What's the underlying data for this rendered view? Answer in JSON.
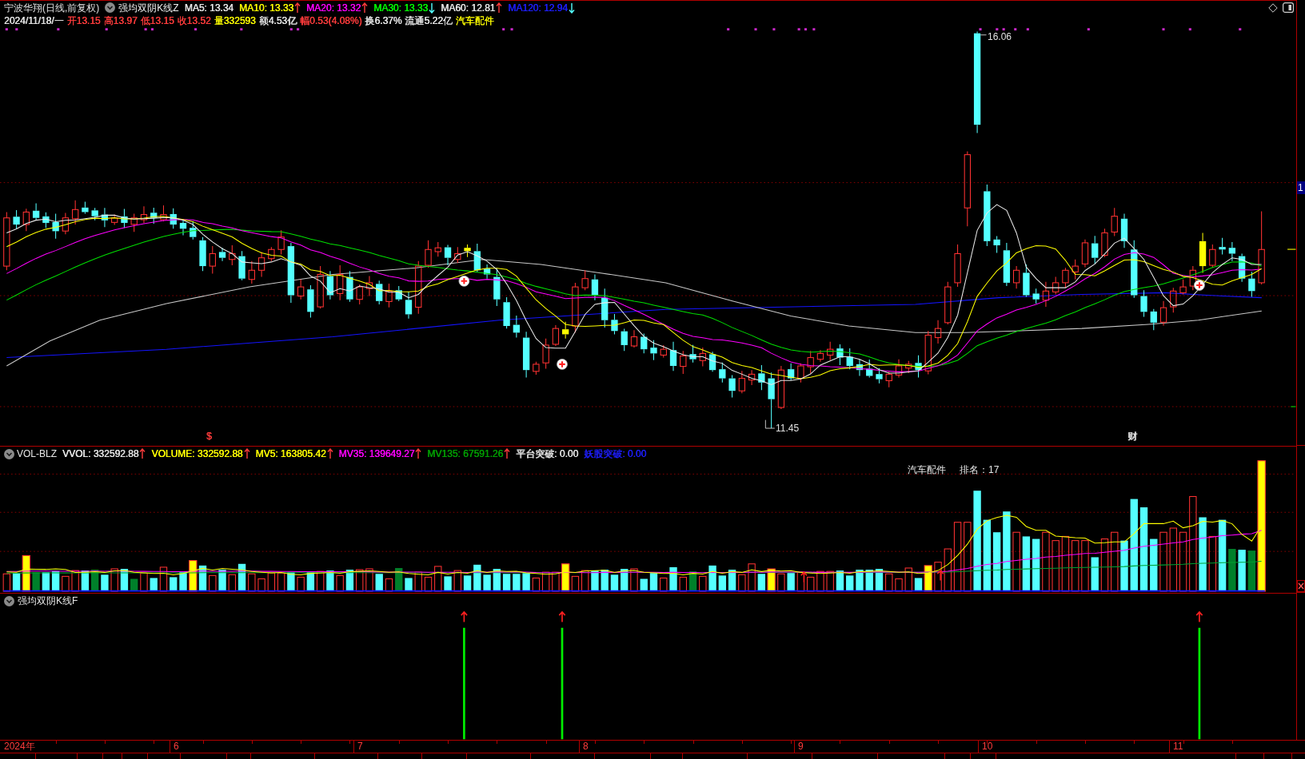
{
  "header": {
    "title": "宁波华翔(日线,前复权)",
    "indicator": "强均双阴K线Z",
    "lines": [
      {
        "label": "MA5: 13.34",
        "color": "#e6e6e6",
        "up_arrow": false,
        "down_arrow": false
      },
      {
        "label": "MA10: 13.33",
        "color": "#ffff00",
        "up_arrow": true,
        "down_arrow": false
      },
      {
        "label": "MA20: 13.32",
        "color": "#ff00ff",
        "up_arrow": true,
        "down_arrow": false
      },
      {
        "label": "MA30: 13.33",
        "color": "#00ff00",
        "up_arrow": false,
        "down_arrow": true
      },
      {
        "label": "MA60: 12.81",
        "color": "#e6e6e6",
        "up_arrow": true,
        "down_arrow": false
      },
      {
        "label": "MA120: 12.94",
        "color": "#1e1eff",
        "up_arrow": false,
        "down_arrow": true
      }
    ]
  },
  "quote": [
    {
      "text": "2024/11/18/一",
      "color": "#e6e6e6"
    },
    {
      "text": "开13.15",
      "color": "#ff3c3c"
    },
    {
      "text": "高13.97",
      "color": "#ff3c3c"
    },
    {
      "text": "低13.15",
      "color": "#ff3c3c"
    },
    {
      "text": "收13.52",
      "color": "#ff3c3c"
    },
    {
      "text": "量332593",
      "color": "#ffff00"
    },
    {
      "text": "额4.53亿",
      "color": "#e6e6e6"
    },
    {
      "text": "幅0.53(4.08%)",
      "color": "#ff3c3c"
    },
    {
      "text": "换6.37%",
      "color": "#e6e6e6"
    },
    {
      "text": "流通5.22亿",
      "color": "#e6e6e6"
    },
    {
      "text": "汽车配件",
      "color": "#ffff00"
    }
  ],
  "price_chart": {
    "high_label": "16.06",
    "low_label": "11.45",
    "axis_label": "1",
    "marks": [
      {
        "text": "$",
        "color": "#ff3c3c"
      },
      {
        "text": "财",
        "color": "#e6e6e6"
      }
    ]
  },
  "volume_panel": {
    "title": "VOL-BLZ",
    "lines": [
      {
        "label": "VVOL: 332592.88",
        "color": "#e6e6e6",
        "up_arrow": true,
        "down_arrow": false
      },
      {
        "label": "VOLUME: 332592.88",
        "color": "#ffff00",
        "up_arrow": true,
        "down_arrow": false
      },
      {
        "label": "MV5: 163805.42",
        "color": "#ffff00",
        "up_arrow": true,
        "down_arrow": false
      },
      {
        "label": "MV35: 139649.27",
        "color": "#ff00ff",
        "up_arrow": true,
        "down_arrow": false
      },
      {
        "label": "MV135: 67591.26",
        "color": "#00a000",
        "up_arrow": true,
        "down_arrow": false
      },
      {
        "label": "平台突破: 0.00",
        "color": "#e6e6e6",
        "up_arrow": false,
        "down_arrow": false
      },
      {
        "label": "妖股突破: 0.00",
        "color": "#1e1eff",
        "up_arrow": false,
        "down_arrow": false
      }
    ],
    "sector": "汽车配件",
    "rank": "排名：17"
  },
  "indicator_panel": {
    "title": "强均双阴K线F"
  },
  "date_axis": [
    "2024年",
    "6",
    "7",
    "8",
    "9",
    "10",
    "11"
  ]
}
